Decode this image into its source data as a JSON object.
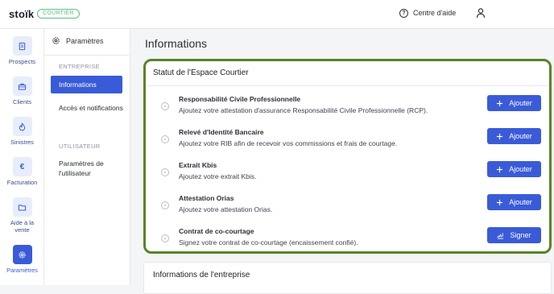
{
  "topbar": {
    "logo": "stoïk",
    "badge": "COURTIER",
    "help_label": "Centre d'aide",
    "help_icon": "?"
  },
  "rail": {
    "items": [
      {
        "label": "Prospects",
        "icon": "document-icon"
      },
      {
        "label": "Clients",
        "icon": "briefcase-icon"
      },
      {
        "label": "Sinistres",
        "icon": "flame-icon"
      },
      {
        "label": "Facturation",
        "icon": "euro-icon"
      },
      {
        "label": "Aide à la vente",
        "icon": "folder-icon"
      },
      {
        "label": "Paramètres",
        "icon": "gear-icon",
        "active": true
      }
    ],
    "euro_glyph": "€"
  },
  "subnav": {
    "title": "Paramètres",
    "section1": "ENTREPRISE",
    "items1": [
      "Informations",
      "Accès et notifications"
    ],
    "section2": "UTILISATEUR",
    "items2": [
      "Paramètres de l'utilisateur"
    ]
  },
  "main": {
    "title": "Informations",
    "status_card": {
      "title": "Statut de l'Espace Courtier",
      "rows": [
        {
          "title": "Responsabilité Civile Professionnelle",
          "desc": "Ajoutez votre attestation d'assurance Responsabilité Civile Professionnelle (RCP).",
          "button": "Ajouter",
          "button_icon": "plus-icon"
        },
        {
          "title": "Relevé d'Identité Bancaire",
          "desc": "Ajoutez votre RIB afin de recevoir vos commissions et frais de courtage.",
          "button": "Ajouter",
          "button_icon": "plus-icon"
        },
        {
          "title": "Extrait Kbis",
          "desc": "Ajoutez votre extrait Kbis.",
          "button": "Ajouter",
          "button_icon": "plus-icon"
        },
        {
          "title": "Attestation Orias",
          "desc": "Ajoutez votre attestation Orias.",
          "button": "Ajouter",
          "button_icon": "plus-icon"
        },
        {
          "title": "Contrat de co-courtage",
          "desc": "Signez votre contrat de co-courtage (encaissement confié).",
          "button": "Signer",
          "button_icon": "signature-icon"
        }
      ]
    },
    "company_card_title": "Informations de l'entreprise"
  },
  "colors": {
    "accent": "#3a5bd8",
    "highlight_border": "#58842a",
    "badge_green": "#5bbf83"
  }
}
